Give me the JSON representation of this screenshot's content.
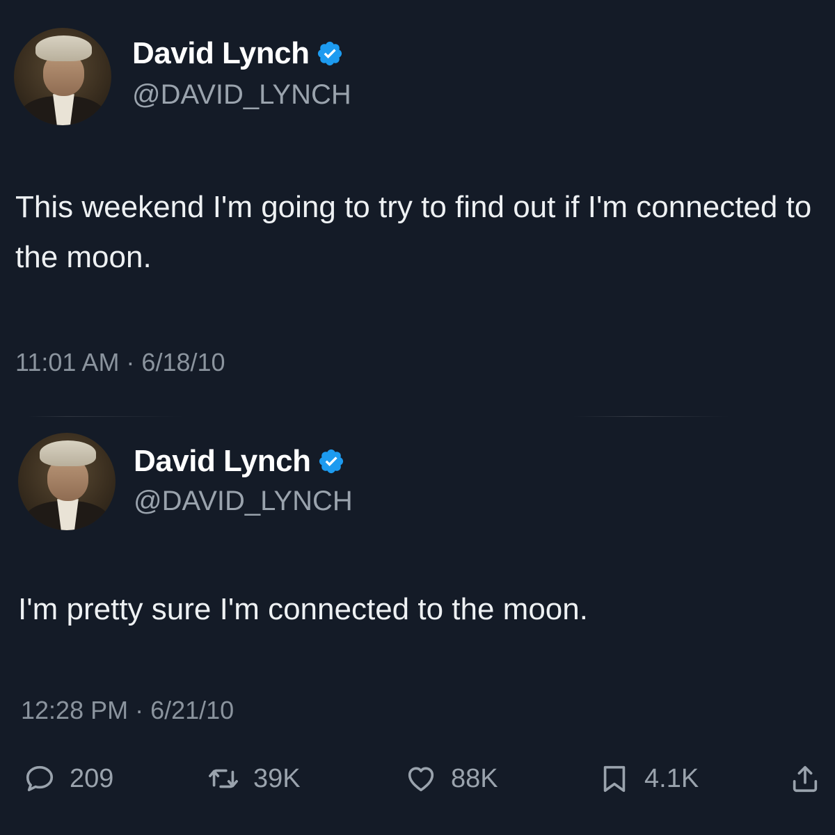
{
  "tweets": [
    {
      "author_name": "David Lynch",
      "author_handle": "@DAVID_LYNCH",
      "text": "This weekend I'm going to try to find out if I'm connected to the moon.",
      "timestamp": "11:01 AM · 6/18/10"
    },
    {
      "author_name": "David Lynch",
      "author_handle": "@DAVID_LYNCH",
      "text": "I'm pretty sure I'm connected to the moon.",
      "timestamp": "12:28 PM · 6/21/10"
    }
  ],
  "actions": {
    "reply_count": "209",
    "retweet_count": "39K",
    "like_count": "88K",
    "bookmark_count": "4.1K"
  },
  "icons": {
    "verified": "verified-badge-icon",
    "reply": "speech-bubble-icon",
    "retweet": "retweet-arrows-icon",
    "like": "heart-icon",
    "bookmark": "bookmark-icon",
    "share": "share-upload-icon"
  },
  "colors": {
    "background": "#141b27",
    "verified": "#1d9bf0",
    "secondary_text": "#9aa3ad"
  }
}
